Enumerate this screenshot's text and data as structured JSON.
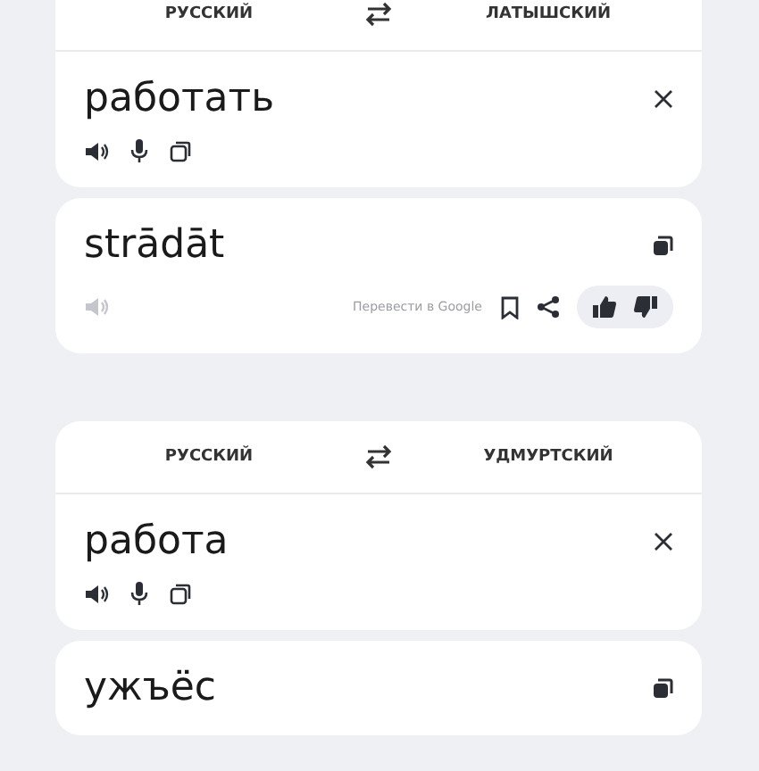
{
  "panels": [
    {
      "source_lang": "РУССКИЙ",
      "target_lang": "ЛАТЫШСКИЙ",
      "source_text": "работать",
      "translation": "strādāt",
      "result_speak_disabled": true,
      "footer": {
        "google_link": "Перевести в Google"
      }
    },
    {
      "source_lang": "РУССКИЙ",
      "target_lang": "УДМУРТСКИЙ",
      "source_text": "работа",
      "translation": "ужъёс"
    }
  ]
}
